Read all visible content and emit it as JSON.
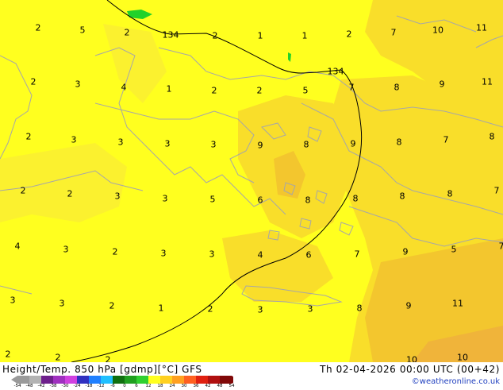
{
  "map": {
    "contour_label": "134",
    "colors": {
      "base_yellow": "#ffff1f",
      "light_orange": "#f9de2a",
      "orange": "#f3c62e",
      "deep_orange": "#f0b43a",
      "coast": "#a7a7a7",
      "contour": "#000000",
      "green_patch": "#22d22a"
    },
    "temperature_values": [
      {
        "text": "2"
      },
      {
        "text": "5"
      },
      {
        "text": "2"
      },
      {
        "text": "134"
      },
      {
        "text": "2"
      },
      {
        "text": "1"
      },
      {
        "text": "1"
      },
      {
        "text": "2"
      },
      {
        "text": "7"
      },
      {
        "text": "10"
      },
      {
        "text": "11"
      },
      {
        "text": "2"
      },
      {
        "text": "3"
      },
      {
        "text": "4"
      },
      {
        "text": "1"
      },
      {
        "text": "2"
      },
      {
        "text": "2"
      },
      {
        "text": "5"
      },
      {
        "text": "134"
      },
      {
        "text": "7"
      },
      {
        "text": "8"
      },
      {
        "text": "9"
      },
      {
        "text": "11"
      },
      {
        "text": "2"
      },
      {
        "text": "3"
      },
      {
        "text": "3"
      },
      {
        "text": "3"
      },
      {
        "text": "3"
      },
      {
        "text": "9"
      },
      {
        "text": "8"
      },
      {
        "text": "9"
      },
      {
        "text": "8"
      },
      {
        "text": "7"
      },
      {
        "text": "8"
      },
      {
        "text": "2"
      },
      {
        "text": "2"
      },
      {
        "text": "3"
      },
      {
        "text": "3"
      },
      {
        "text": "5"
      },
      {
        "text": "6"
      },
      {
        "text": "8"
      },
      {
        "text": "8"
      },
      {
        "text": "8"
      },
      {
        "text": "8"
      },
      {
        "text": "7"
      },
      {
        "text": "4"
      },
      {
        "text": "3"
      },
      {
        "text": "2"
      },
      {
        "text": "3"
      },
      {
        "text": "3"
      },
      {
        "text": "4"
      },
      {
        "text": "6"
      },
      {
        "text": "7"
      },
      {
        "text": "9"
      },
      {
        "text": "5"
      },
      {
        "text": "7"
      },
      {
        "text": "3"
      },
      {
        "text": "3"
      },
      {
        "text": "2"
      },
      {
        "text": "1"
      },
      {
        "text": "2"
      },
      {
        "text": "3"
      },
      {
        "text": "3"
      },
      {
        "text": "8"
      },
      {
        "text": "9"
      },
      {
        "text": "11"
      },
      {
        "text": "2"
      },
      {
        "text": "2"
      },
      {
        "text": "2"
      },
      {
        "text": "10"
      },
      {
        "text": "10"
      }
    ]
  },
  "footer": {
    "title": "Height/Temp. 850 hPa [gdmp][°C] GFS",
    "valid_time": "Th 02-04-2026 00:00 UTC (00+42)",
    "credit": "©weatheronline.co.uk",
    "scale_labels": [
      "-54",
      "-48",
      "-42",
      "-38",
      "-30",
      "-24",
      "-18",
      "-12",
      "-6",
      "0",
      "6",
      "12",
      "18",
      "24",
      "30",
      "36",
      "42",
      "48",
      "54"
    ],
    "scale_colors": [
      "#9a9a9a",
      "#b3b3b3",
      "#6e1f8c",
      "#a030c0",
      "#d040e0",
      "#3030c0",
      "#2080ff",
      "#20c0ff",
      "#107010",
      "#20a020",
      "#30d030",
      "#ffff20",
      "#ffd020",
      "#ffa020",
      "#ff6020",
      "#e02010",
      "#b01010",
      "#800808"
    ]
  }
}
